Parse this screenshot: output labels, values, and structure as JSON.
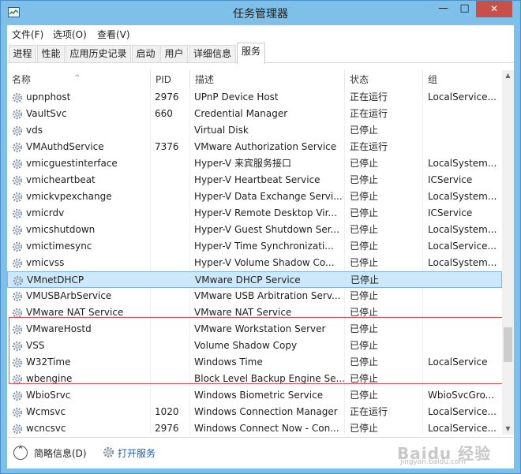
{
  "window": {
    "title": "任务管理器",
    "minimize": "—",
    "maximize": "□",
    "close": "✕"
  },
  "menu": [
    "文件(F)",
    "选项(O)",
    "查看(V)"
  ],
  "tabs": [
    "进程",
    "性能",
    "应用历史记录",
    "启动",
    "用户",
    "详细信息",
    "服务"
  ],
  "active_tab": "服务",
  "columns": {
    "name": "名称",
    "pid": "PID",
    "desc": "描述",
    "status": "状态",
    "group": "组"
  },
  "rows": [
    {
      "name": "upnphost",
      "pid": "2976",
      "desc": "UPnP Device Host",
      "status": "正在运行",
      "group": "LocalService..."
    },
    {
      "name": "VaultSvc",
      "pid": "660",
      "desc": "Credential Manager",
      "status": "正在运行",
      "group": ""
    },
    {
      "name": "vds",
      "pid": "",
      "desc": "Virtual Disk",
      "status": "已停止",
      "group": ""
    },
    {
      "name": "VMAuthdService",
      "pid": "7376",
      "desc": "VMware Authorization Service",
      "status": "正在运行",
      "group": ""
    },
    {
      "name": "vmicguestinterface",
      "pid": "",
      "desc": "Hyper-V 来宾服务接口",
      "status": "已停止",
      "group": "LocalSystem..."
    },
    {
      "name": "vmicheartbeat",
      "pid": "",
      "desc": "Hyper-V Heartbeat Service",
      "status": "已停止",
      "group": "ICService"
    },
    {
      "name": "vmickvpexchange",
      "pid": "",
      "desc": "Hyper-V Data Exchange Servi...",
      "status": "已停止",
      "group": "LocalSystem..."
    },
    {
      "name": "vmicrdv",
      "pid": "",
      "desc": "Hyper-V Remote Desktop Vir...",
      "status": "已停止",
      "group": "ICService"
    },
    {
      "name": "vmicshutdown",
      "pid": "",
      "desc": "Hyper-V Guest Shutdown Ser...",
      "status": "已停止",
      "group": "LocalSystem..."
    },
    {
      "name": "vmictimesync",
      "pid": "",
      "desc": "Hyper-V Time Synchronizati...",
      "status": "已停止",
      "group": "LocalService..."
    },
    {
      "name": "vmicvss",
      "pid": "",
      "desc": "Hyper-V Volume Shadow Co...",
      "status": "已停止",
      "group": "LocalSystem..."
    },
    {
      "name": "VMnetDHCP",
      "pid": "",
      "desc": "VMware DHCP Service",
      "status": "已停止",
      "group": ""
    },
    {
      "name": "VMUSBArbService",
      "pid": "",
      "desc": "VMware USB Arbitration Serv...",
      "status": "已停止",
      "group": ""
    },
    {
      "name": "VMware NAT Service",
      "pid": "",
      "desc": "VMware NAT Service",
      "status": "已停止",
      "group": ""
    },
    {
      "name": "VMwareHostd",
      "pid": "",
      "desc": "VMware Workstation Server",
      "status": "已停止",
      "group": ""
    },
    {
      "name": "VSS",
      "pid": "",
      "desc": "Volume Shadow Copy",
      "status": "已停止",
      "group": ""
    },
    {
      "name": "W32Time",
      "pid": "",
      "desc": "Windows Time",
      "status": "已停止",
      "group": "LocalService"
    },
    {
      "name": "wbengine",
      "pid": "",
      "desc": "Block Level Backup Engine Se...",
      "status": "已停止",
      "group": ""
    },
    {
      "name": "WbioSrvc",
      "pid": "",
      "desc": "Windows Biometric Service",
      "status": "已停止",
      "group": "WbioSvcGro..."
    },
    {
      "name": "Wcmsvc",
      "pid": "1020",
      "desc": "Windows Connection Manager",
      "status": "正在运行",
      "group": "LocalService..."
    },
    {
      "name": "wcncsvc",
      "pid": "2976",
      "desc": "Windows Connect Now - Con...",
      "status": "已停止",
      "group": "LocalService..."
    }
  ],
  "selected_row": "VMnetDHCP",
  "bottom": {
    "fewer_details": "简略信息(D)",
    "open_services": "打开服务"
  },
  "watermark": {
    "brand": "Baidu 经验",
    "url": "jingyan.baidu.com"
  },
  "colors": {
    "selection": "#cde8fb",
    "highlight_box": "#e04a55",
    "link": "#1a5fb4"
  }
}
